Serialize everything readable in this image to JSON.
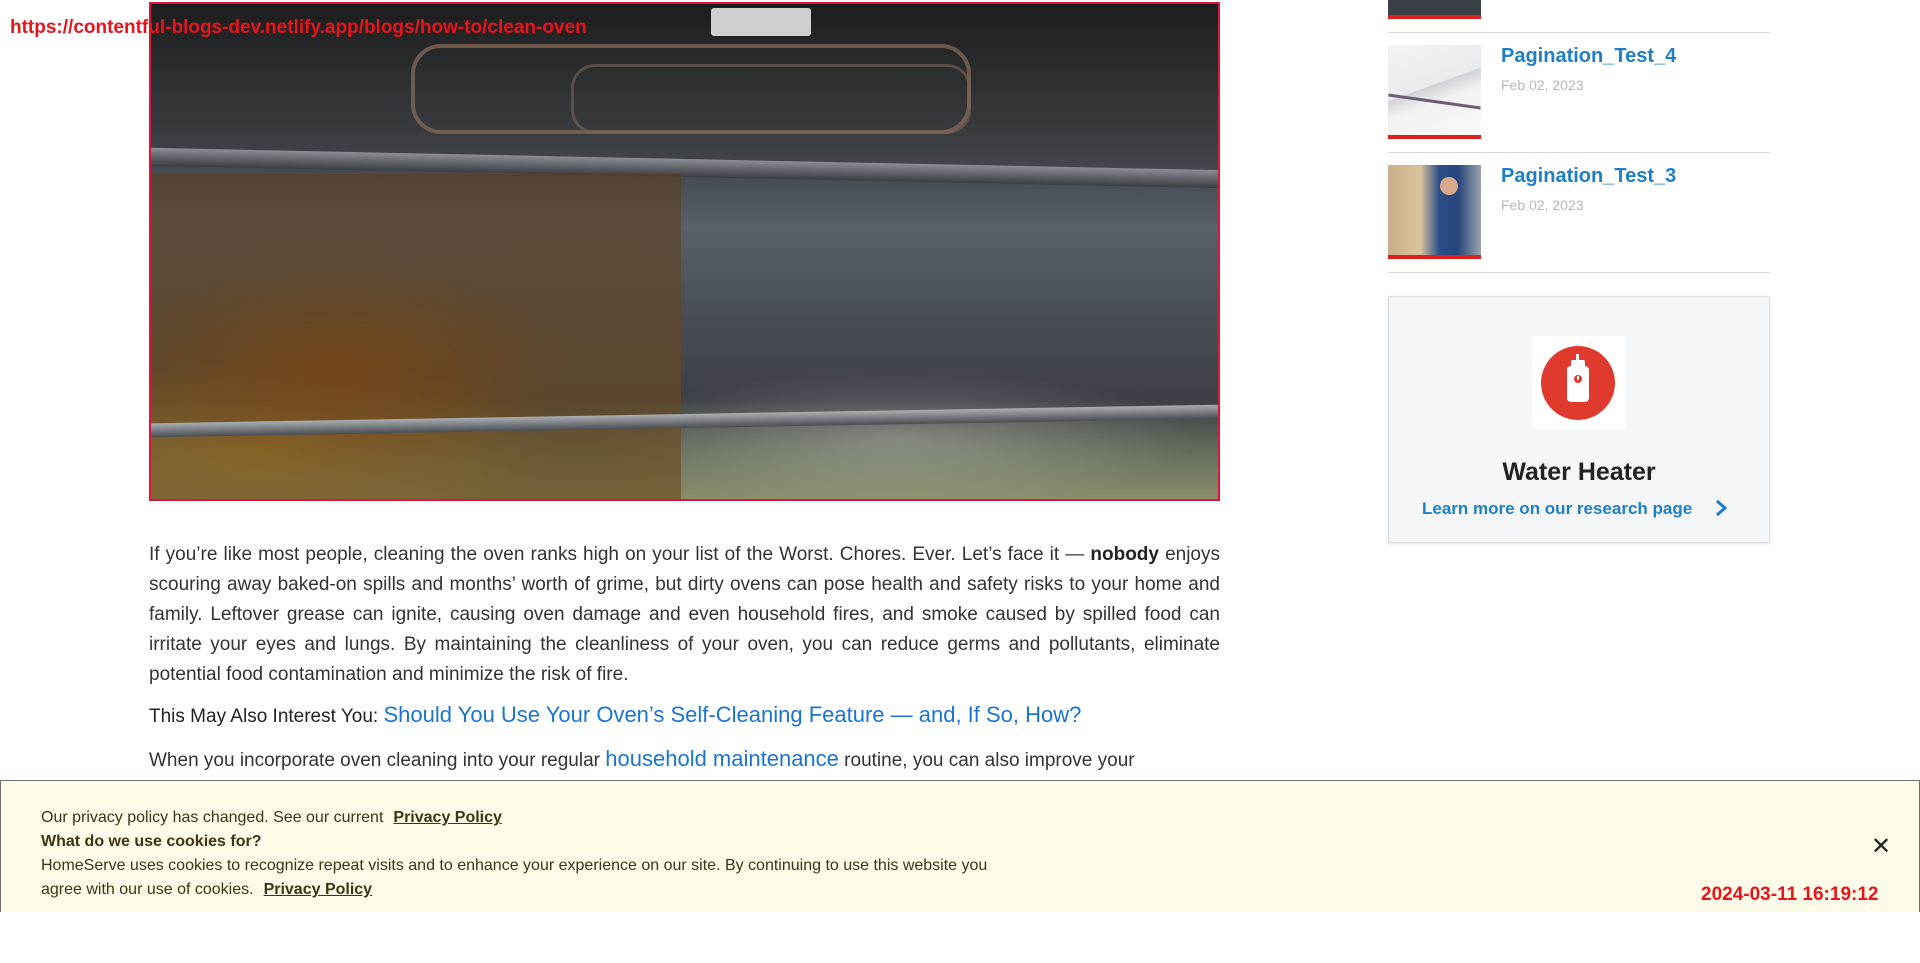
{
  "overlay": {
    "url": "https://contentful-blogs-dev.netlify.app/blogs/how-to/clean-oven",
    "timestamp": "2024-03-11 16:19:12"
  },
  "article": {
    "paragraph1_a": "If you’re like most people, cleaning the oven ranks high on your list of the Worst. Chores. Ever. Let’s face it — ",
    "paragraph1_bold": "nobody",
    "paragraph1_b": " enjoys scouring away baked-on spills and months’ worth of grime, but dirty ovens can pose health and safety risks to your home and family. Leftover grease can ignite, causing oven damage and even household fires, and smoke caused by spilled food can irritate your eyes and lungs. By maintaining the cleanliness of your oven, you can reduce germs and pollutants, eliminate potential food contamination and minimize the risk of fire.",
    "interest_label": "This May Also Interest You:",
    "interest_link": "Should You Use Your Oven’s Self-Cleaning Feature — and, If So, How?",
    "paragraph2_a": "When you incorporate oven cleaning into your regular ",
    "paragraph2_link": "household maintenance",
    "paragraph2_b": " routine, you can also improve your"
  },
  "sidebar": {
    "items": [
      {
        "title": "Pagination_Test_4",
        "date": "Feb 02, 2023"
      },
      {
        "title": "Pagination_Test_3",
        "date": "Feb 02, 2023"
      }
    ],
    "card": {
      "title": "Water Heater",
      "link": "Learn more on our research page"
    }
  },
  "cookie": {
    "line1": "Our privacy policy has changed. See our current",
    "link1": "Privacy Policy",
    "line2": "What do we use cookies for?",
    "line3": "HomeServe uses cookies to recognize repeat visits and to enhance your experience on our site. By continuing to use this website you",
    "line4": "agree with our use of cookies.",
    "link2": "Privacy Policy",
    "close": "✕"
  },
  "colors": {
    "accent_blue": "#1e7fc7",
    "link_blue": "#1a75d1",
    "brand_red": "#e03a2f",
    "overlay_red": "#e8141c",
    "cookie_bg": "#fefbe8"
  }
}
